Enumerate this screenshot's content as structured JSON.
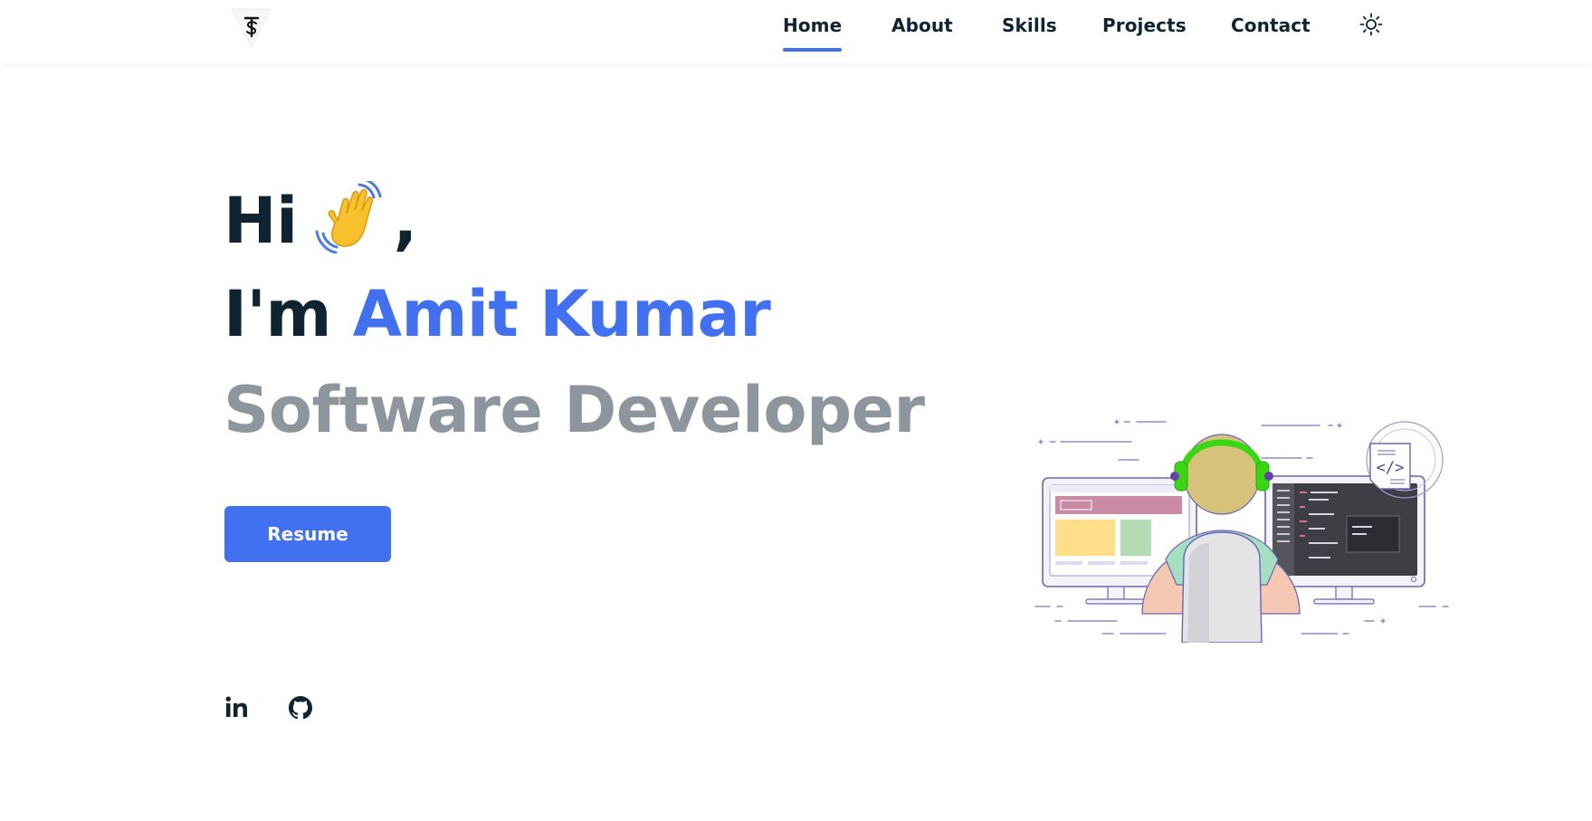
{
  "header": {
    "logo": {
      "icon": "ts-logo-icon"
    },
    "nav": [
      {
        "label": "Home",
        "active": true
      },
      {
        "label": "About",
        "active": false
      },
      {
        "label": "Skills",
        "active": false
      },
      {
        "label": "Projects",
        "active": false
      },
      {
        "label": "Contact",
        "active": false
      }
    ],
    "theme_toggle": {
      "icon": "sun-icon"
    }
  },
  "hero": {
    "greeting": "Hi",
    "greeting_emoji": "waving-hand-icon",
    "greeting_suffix": ",",
    "intro_prefix": "I'm",
    "name": "Amit Kumar",
    "role": "Software Developer",
    "resume_label": "Resume"
  },
  "social": [
    {
      "icon": "linkedin-icon"
    },
    {
      "icon": "github-icon"
    }
  ],
  "illustration": {
    "icon": "developer-at-desk-illustration"
  },
  "colors": {
    "accent": "#4171f0",
    "text_dark": "#0f2430",
    "text_muted": "#8e969d",
    "headphones": "#37d812",
    "background": "#ffffff"
  }
}
